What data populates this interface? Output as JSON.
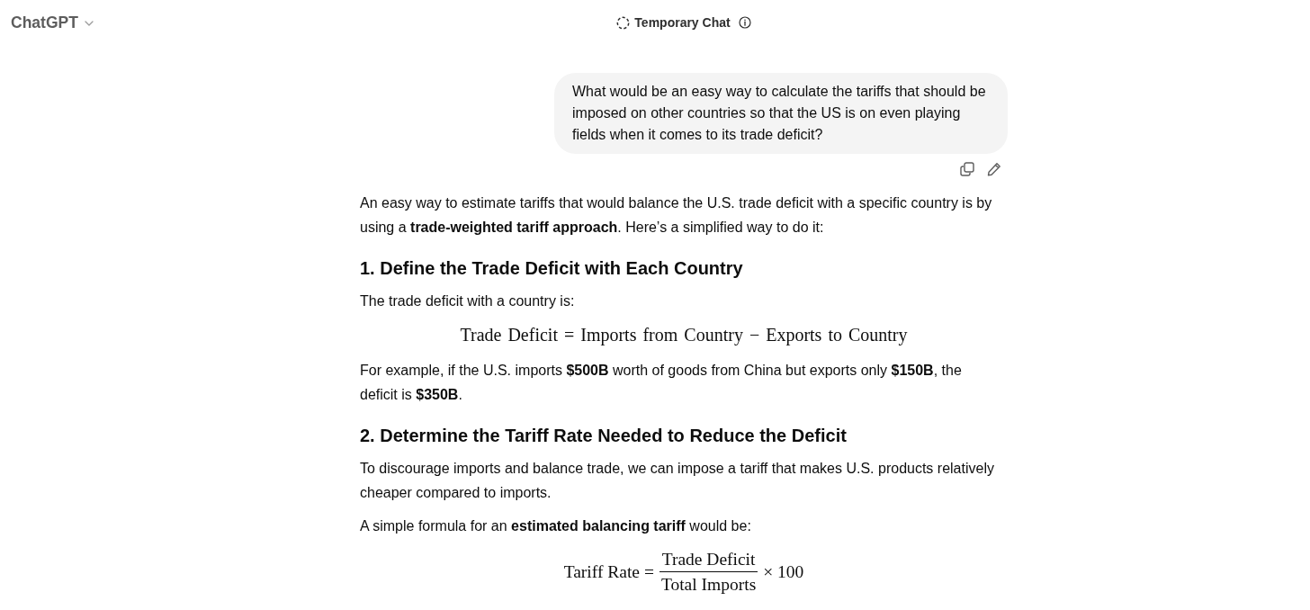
{
  "header": {
    "model_menu": {
      "label": "ChatGPT"
    },
    "temporary_chat": {
      "label": "Temporary Chat"
    }
  },
  "conversation": {
    "user_message": {
      "text": "What would be an easy way to calculate the tariffs that should be imposed on other countries so that the US is on even playing fields when it comes to its trade deficit?"
    },
    "assistant_message": {
      "blocks": [
        {
          "kind": "paragraph",
          "text": "An easy way to estimate tariffs that would balance the U.S. trade deficit with a specific country is by using a **trade-weighted tariff approach**. Here’s a simplified way to do it:"
        },
        {
          "kind": "heading",
          "text": "1. Define the Trade Deficit with Each Country"
        },
        {
          "kind": "paragraph",
          "text": "The trade deficit with a country is:"
        },
        {
          "kind": "equation",
          "text": "Trade Deficit = Imports from Country − Exports to Country"
        },
        {
          "kind": "paragraph",
          "text": "For example, if the U.S. imports **$500B** worth of goods from China but exports only **$150B**, the deficit is **$350B**."
        },
        {
          "kind": "heading",
          "text": "2. Determine the Tariff Rate Needed to Reduce the Deficit"
        },
        {
          "kind": "paragraph",
          "text": "To discourage imports and balance trade, we can impose a tariff that makes U.S. products relatively cheaper compared to imports."
        },
        {
          "kind": "paragraph",
          "text": "A simple formula for an **estimated balancing tariff** would be:"
        },
        {
          "kind": "fraction_equation",
          "lhs": "Tariff Rate =",
          "numerator": "Trade Deficit",
          "denominator": "Total Imports",
          "rhs": "× 100"
        }
      ]
    }
  }
}
